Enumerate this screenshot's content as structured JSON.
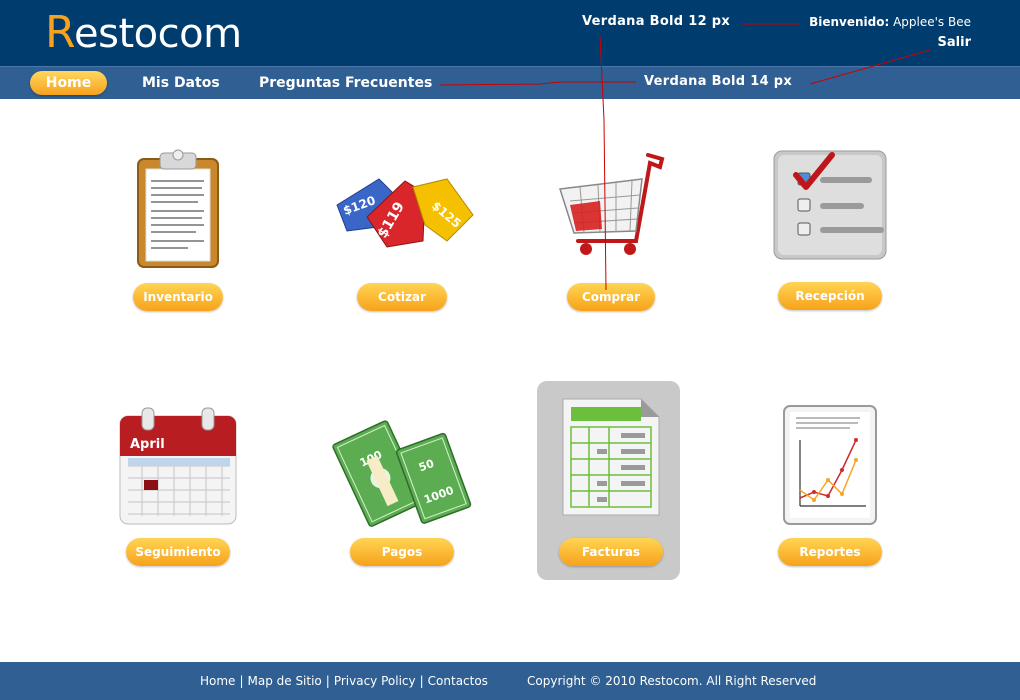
{
  "brand": {
    "logo_first": "R",
    "logo_rest": "estocom",
    "accent_color": "#f6a21e",
    "header_color": "#003c6e",
    "nav_color": "#2f5f93"
  },
  "annotations": {
    "top": "Verdana Bold 12 px",
    "nav": "Verdana Bold 14 px",
    "line_color": "#cc0000"
  },
  "user": {
    "welcome_label": "Bienvenido:",
    "name": "Applee's Bee",
    "logout": "Salir"
  },
  "nav": {
    "items": [
      "Home",
      "Mis Datos",
      "Preguntas Frecuentes"
    ],
    "active": "Home"
  },
  "tiles": [
    {
      "label": "Inventario",
      "icon": "clipboard-icon"
    },
    {
      "label": "Cotizar",
      "icon": "price-tags-icon",
      "tags": [
        "$120",
        "$119",
        "$125"
      ]
    },
    {
      "label": "Comprar",
      "icon": "shopping-cart-icon"
    },
    {
      "label": "Recepción",
      "icon": "checklist-icon"
    },
    {
      "label": "Seguimiento",
      "icon": "calendar-icon",
      "month": "April"
    },
    {
      "label": "Pagos",
      "icon": "money-stack-icon",
      "bills": [
        "100",
        "50",
        "1000"
      ]
    },
    {
      "label": "Facturas",
      "icon": "invoice-sheet-icon",
      "selected": true
    },
    {
      "label": "Reportes",
      "icon": "report-chart-icon"
    }
  ],
  "footer": {
    "links": [
      "Home",
      "Map de Sitio",
      "Privacy Policy",
      "Contactos"
    ],
    "copyright": "Copyright © 2010 Restocom. All Right Reserved"
  }
}
